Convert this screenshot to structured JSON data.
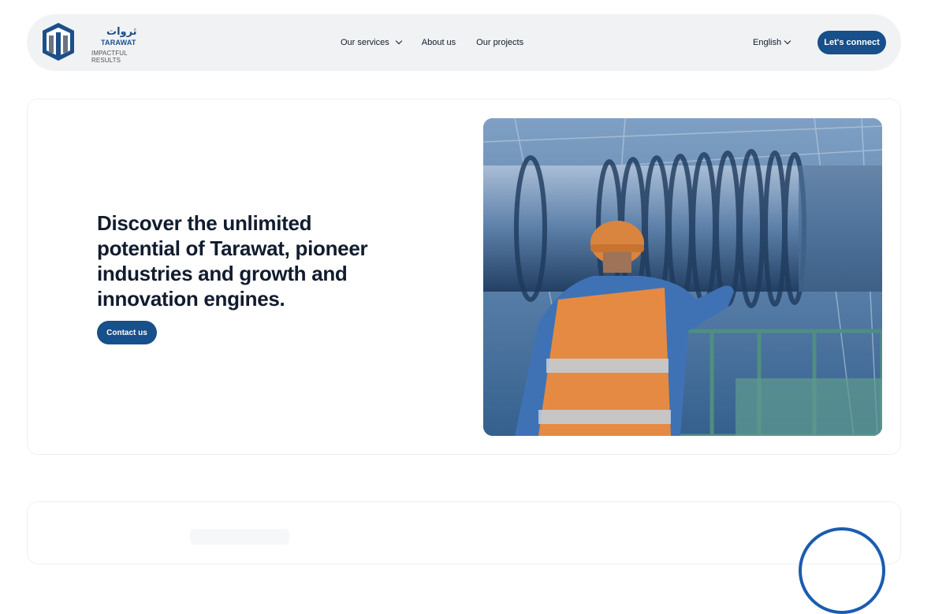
{
  "brand": {
    "name_ar": "ثروات",
    "name_en": "TARAWAT",
    "tagline": "IMPACTFUL RESULTS",
    "primary_color": "#17508a"
  },
  "nav": {
    "items": [
      {
        "label": "Our services",
        "has_dropdown": true
      },
      {
        "label": "About us",
        "has_dropdown": false
      },
      {
        "label": "Our projects",
        "has_dropdown": false
      }
    ],
    "language": "English",
    "cta": "Let's connect"
  },
  "hero": {
    "title": "Discover the unlimited potential of Tarawat, pioneer industries and growth and innovation engines.",
    "button": "Contact us",
    "image_icon": "industrial-worker-photo"
  }
}
